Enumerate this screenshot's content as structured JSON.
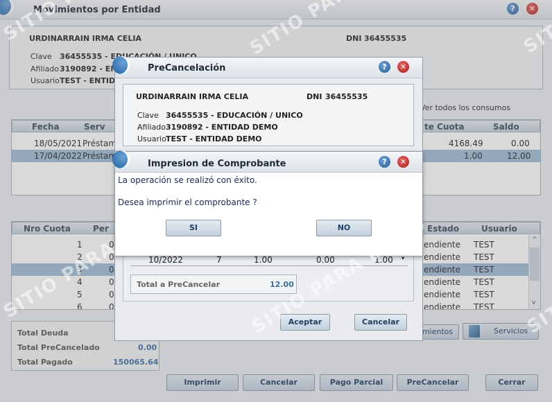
{
  "main": {
    "title": "Movimientos por Entidad",
    "person_name": "URDINARRAIN IRMA CELIA",
    "dni_label": "DNI",
    "dni": "36455535",
    "clave_label": "Clave",
    "clave_value": "36455535  -  EDUCACIÓN / UNICO",
    "afiliado_label": "Afiliado",
    "afiliado_value": "3190892  -  EN",
    "usuario_label": "Usuario",
    "usuario_value": "TEST  -  ENTID",
    "ver_todos": "Ver todos los consumos",
    "consumos_headers": {
      "fecha": "Fecha",
      "serv": "Serv",
      "cuota": "te Cuota",
      "saldo": "Saldo"
    },
    "consumos_rows": [
      {
        "fecha": "18/05/2021",
        "serv": "Préstam",
        "cuota": "4168.49",
        "saldo": "0.00"
      },
      {
        "fecha": "17/04/2022",
        "serv": "Préstam",
        "cuota": "1.00",
        "saldo": "12.00"
      }
    ],
    "cuotas_headers": {
      "nro": "Nro Cuota",
      "per": "Per",
      "estado": "Estado",
      "usuario": "Usuario"
    },
    "cuotas_rows": [
      {
        "nro": "1",
        "per": "0",
        "estado": "endiente",
        "usuario": "TEST"
      },
      {
        "nro": "2",
        "per": "0",
        "estado": "endiente",
        "usuario": "TEST"
      },
      {
        "nro": "3",
        "per": "0",
        "estado": "endiente",
        "usuario": "TEST"
      },
      {
        "nro": "4",
        "per": "0",
        "estado": "endiente",
        "usuario": "TEST"
      },
      {
        "nro": "5",
        "per": "0",
        "estado": "endiente",
        "usuario": "TEST"
      },
      {
        "nro": "6",
        "per": "0",
        "estado": "endiente",
        "usuario": "TEST"
      }
    ],
    "totals": {
      "deuda_label": "Total Deuda",
      "precancelado_label": "Total PreCancelado",
      "precancelado_value": "0.00",
      "pagado_label": "Total Pagado",
      "pagado_value": "150065.64"
    },
    "movimientos_btn": "mientos",
    "servicios_btn": "Servicios",
    "buttons": {
      "imprimir": "Imprimir",
      "cancelar": "Cancelar",
      "pago_parcial": "Pago Parcial",
      "precancelar": "PreCancelar",
      "cerrar": "Cerrar"
    }
  },
  "precancel": {
    "title": "PreCancelación",
    "person_name": "URDINARRAIN IRMA CELIA",
    "dni_label": "DNI",
    "dni": "36455535",
    "clave_label": "Clave",
    "clave_value": "36455535  -  EDUCACIÓN / UNICO",
    "afiliado_label": "Afiliado",
    "afiliado_value": "3190892  -  ENTIDAD DEMO",
    "usuario_label": "Usuario",
    "usuario_value": "TEST  -  ENTIDAD DEMO",
    "row": {
      "periodo": "10/2022",
      "cuota": "7",
      "importe": "1.00",
      "interes": "0.00",
      "total": "1.00"
    },
    "total_label": "Total a PreCancelar",
    "total_value": "12.00",
    "aceptar": "Aceptar",
    "cancelar": "Cancelar"
  },
  "dialog": {
    "title": "Impresion de Comprobante",
    "message": "La operación se realizó con éxito.",
    "question": "Desea imprimir el comprobante ?",
    "si": "SI",
    "no": "NO"
  },
  "icons": {
    "help": "?",
    "close": "✕"
  },
  "watermark": "SITIO PARA DEMO",
  "colors": {
    "selected_row": "#9fbbd6",
    "button_text": "#1f3e63",
    "value_blue": "#3a6ea5"
  }
}
